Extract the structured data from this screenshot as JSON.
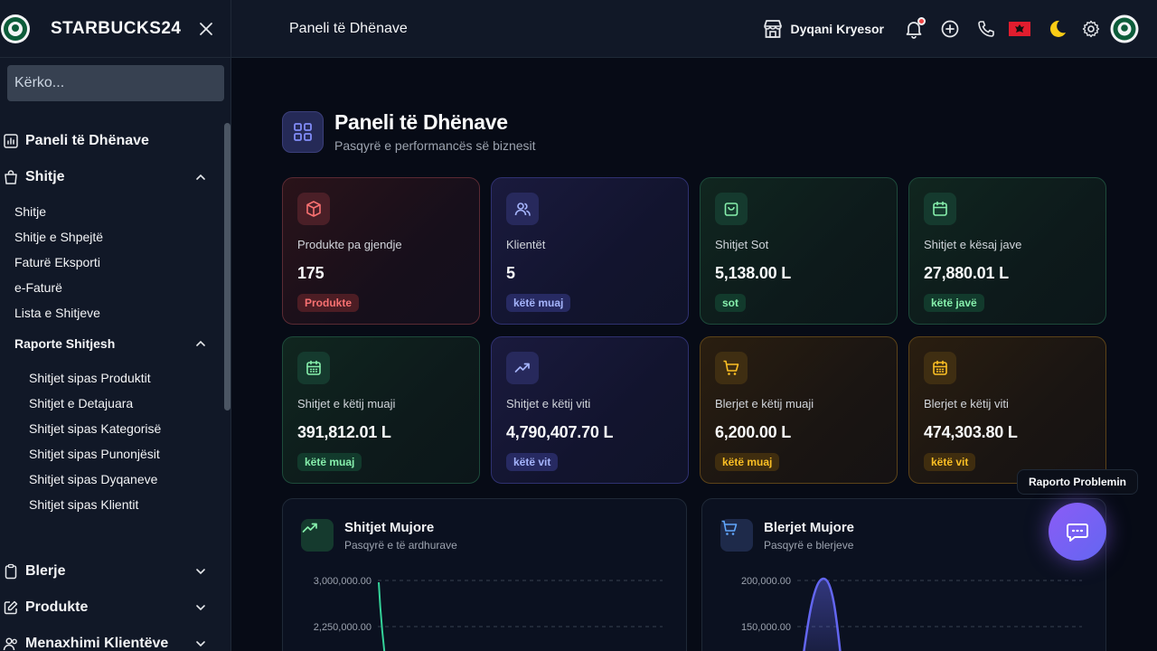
{
  "sidebar": {
    "brand": "STARBUCKS24",
    "search_placeholder": "Kërko...",
    "items": [
      {
        "label": "Paneli të Dhënave"
      },
      {
        "label": "Shitje"
      },
      {
        "label": "Blerje"
      },
      {
        "label": "Produkte"
      },
      {
        "label": "Menaxhimi Klientëve"
      }
    ],
    "sales_sub": [
      "Shitje",
      "Shitje e Shpejtë",
      "Faturë Eksporti",
      "e-Faturë",
      "Lista e Shitjeve"
    ],
    "reports_label": "Raporte Shitjesh",
    "reports_sub": [
      "Shitjet sipas Produktit",
      "Shitjet e Detajuara",
      "Shitjet sipas Kategorisë",
      "Shitjet sipas Punonjësit",
      "Shitjet sipas Dyqaneve",
      "Shitjet sipas Klientit"
    ]
  },
  "header": {
    "title": "Paneli të Dhënave",
    "store": "Dyqani Kryesor"
  },
  "page": {
    "title": "Paneli të Dhënave",
    "subtitle": "Pasqyrë e performancës së biznesit"
  },
  "cards": [
    {
      "label": "Produkte pa gjendje",
      "value": "175",
      "badge": "Produkte"
    },
    {
      "label": "Klientët",
      "value": "5",
      "badge": "këtë muaj"
    },
    {
      "label": "Shitjet Sot",
      "value": "5,138.00 L",
      "badge": "sot"
    },
    {
      "label": "Shitjet e kësaj jave",
      "value": "27,880.01 L",
      "badge": "këtë javë"
    },
    {
      "label": "Shitjet e këtij muaji",
      "value": "391,812.01 L",
      "badge": "këtë muaj"
    },
    {
      "label": "Shitjet e këtij viti",
      "value": "4,790,407.70 L",
      "badge": "këtë vit"
    },
    {
      "label": "Blerjet e këtij muaji",
      "value": "6,200.00 L",
      "badge": "këtë muaj"
    },
    {
      "label": "Blerjet e këtij viti",
      "value": "474,303.80 L",
      "badge": "këtë vit"
    }
  ],
  "charts": [
    {
      "title": "Shitjet Mujore",
      "subtitle": "Pasqyrë e të ardhurave",
      "ticks": [
        "3,000,000.00",
        "2,250,000.00"
      ]
    },
    {
      "title": "Blerjet Mujore",
      "subtitle": "Pasqyrë e blerjeve",
      "ticks": [
        "200,000.00",
        "150,000.00"
      ]
    }
  ],
  "report": {
    "label": "Raporto Problemin"
  },
  "colors": {
    "accent": "#6366f1",
    "red": "#f87171",
    "green": "#86efac",
    "amber": "#fbbf24",
    "indigo": "#a5b4fc"
  }
}
